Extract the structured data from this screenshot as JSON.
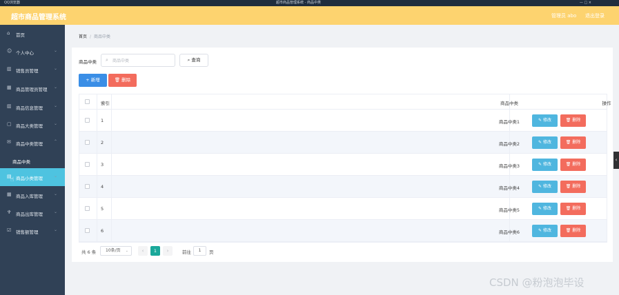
{
  "top_strip": {
    "left": "QQ浏览器",
    "center": "超市商品管理系统 - 商品中类",
    "right": "— □ ×"
  },
  "header": {
    "title": "超市商品管理系统",
    "admin": "管理员 abo",
    "logout": "退出登录"
  },
  "sidebar": {
    "items": [
      {
        "label": "首页",
        "icon": "home-icon",
        "glyph": "⌂"
      },
      {
        "label": "个人中心",
        "icon": "user-icon",
        "glyph": "☺"
      },
      {
        "label": "销售员管理",
        "icon": "chart-icon",
        "glyph": "▥"
      },
      {
        "label": "商品管理员管理",
        "icon": "grid-icon",
        "glyph": "▦"
      },
      {
        "label": "商品信息管理",
        "icon": "bars-icon",
        "glyph": "▥"
      },
      {
        "label": "商品大类管理",
        "icon": "box-icon",
        "glyph": "▢"
      },
      {
        "label": "商品中类管理",
        "icon": "mail-icon",
        "glyph": "✉"
      },
      {
        "label": "商品中类",
        "icon": "",
        "glyph": ""
      },
      {
        "label": "商品小类管理",
        "icon": "doc-icon",
        "glyph": "▤"
      },
      {
        "label": "商品入库管理",
        "icon": "grid-icon",
        "glyph": "▦"
      },
      {
        "label": "商品出库管理",
        "icon": "trophy-icon",
        "glyph": "♆"
      },
      {
        "label": "销售额管理",
        "icon": "check-icon",
        "glyph": "☑"
      }
    ],
    "chevron": "⌄"
  },
  "breadcrumb": {
    "home": "首页",
    "sep": "/",
    "current": "商品中类"
  },
  "search": {
    "label": "商品中类",
    "placeholder": "商品中类",
    "query_label": "查询"
  },
  "toolbar": {
    "add_label": "新增",
    "delete_label": "删除"
  },
  "table": {
    "headers": {
      "index": "索引",
      "name": "商品中类",
      "ops": "操作"
    },
    "rows": [
      {
        "index": "1",
        "name": "商品中类1"
      },
      {
        "index": "2",
        "name": "商品中类2"
      },
      {
        "index": "3",
        "name": "商品中类3"
      },
      {
        "index": "4",
        "name": "商品中类4"
      },
      {
        "index": "5",
        "name": "商品中类5"
      },
      {
        "index": "6",
        "name": "商品中类6"
      }
    ],
    "edit_label": "修改",
    "delete_label": "删除"
  },
  "pagination": {
    "total": "共 6 条",
    "page_size": "10条/页",
    "current_page": "1",
    "goto_label": "前往",
    "goto_value": "1",
    "page_label": "页",
    "prev": "‹",
    "next": "›"
  },
  "watermark": "CSDN @粉泡泡毕设",
  "colors": {
    "header": "#fdd36f",
    "sidebar": "#304156",
    "active": "#4ec3e0",
    "primary": "#3a8ee6",
    "danger": "#f36c5d",
    "edit": "#4fb6df",
    "page_active": "#1aa89a"
  }
}
